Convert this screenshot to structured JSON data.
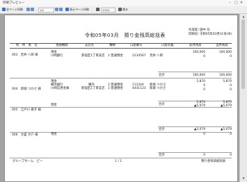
{
  "window": {
    "title": "印刷プレビュー"
  },
  "toolbar": {
    "all_pages_print": "全ページ印刷",
    "page_input": "1/2",
    "this_page_print": "表示ページ印刷",
    "zoom": "100%",
    "close": "閉る"
  },
  "report": {
    "title": "令和05年03月　預り金残高総括表",
    "creator_label": "作成者：",
    "creator_value": "田中 均",
    "print_date_label": "印刷日：",
    "print_date_value": "令和05年03月31日(木)",
    "headers": {
      "name": "利　用　者　名",
      "bank": "金融機関",
      "branch": "支店名",
      "type": "種類",
      "account_no": "口座番号",
      "holder": "口座名義",
      "prev_balance": "前月残高",
      "curr_balance": "当月残高"
    },
    "users": [
      {
        "name": "003　荒井 八郎 様",
        "lines": [
          {
            "bank": "現金",
            "branch": "",
            "type": "",
            "account_no": "",
            "holder": "",
            "prev": "100,000",
            "curr": "100,000"
          },
          {
            "bank": "川崎銀行",
            "branch": "新宿区1丁目支店",
            "type": "1:普通預金",
            "account_no": "1234567",
            "holder": "荒井 八郎",
            "prev": "0",
            "curr": "0"
          }
        ],
        "total_label": "合計",
        "total_prev": "100,000",
        "total_curr": "100,000"
      },
      {
        "name": "004　新堀 つかさ 様",
        "lines": [
          {
            "bank": "現金",
            "branch": "",
            "type": "",
            "account_no": "",
            "holder": "",
            "prev": "5,870",
            "curr": "5,870"
          },
          {
            "bank": "横浜銀行",
            "branch": "横浜",
            "type": "1:普通預金",
            "account_no": "112344",
            "holder": "新堀 つかさ",
            "prev": "0",
            "curr": "0"
          },
          {
            "bank": "川崎信用金庫",
            "branch": "新宿区1丁目支店",
            "type": "1:普通預金",
            "account_no": "4441123",
            "holder": "新堀 つかさ",
            "prev": "0",
            "curr": "0"
          }
        ],
        "total_label": "合計",
        "total_prev": "5,870",
        "total_curr": "5,870"
      },
      {
        "name": "005　江戸川 春子 様",
        "lines": [
          {
            "bank": "現金",
            "branch": "",
            "type": "",
            "account_no": "",
            "holder": "",
            "prev": "▲5,079",
            "curr": "▲5,079"
          }
        ],
        "total_label": "合計",
        "total_prev": "▲5,079",
        "total_curr": "▲5,079"
      },
      {
        "name": "006　大盛 大介 様",
        "lines": [
          {
            "bank": "現金",
            "branch": "",
            "type": "",
            "account_no": "",
            "holder": "",
            "prev": "0",
            "curr": "0"
          }
        ],
        "total_label": "合計",
        "total_prev": "0",
        "total_curr": "0"
      }
    ],
    "footer": {
      "group_name": "グループホーム　ピー",
      "page": "1 / 2",
      "report_name": "預り金残高総括表"
    }
  }
}
